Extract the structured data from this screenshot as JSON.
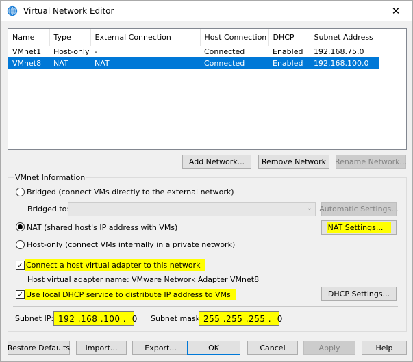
{
  "window": {
    "title": "Virtual Network Editor",
    "close": "✕"
  },
  "list": {
    "columns": [
      "Name",
      "Type",
      "External Connection",
      "Host Connection",
      "DHCP",
      "Subnet Address"
    ],
    "rows": [
      {
        "name": "VMnet1",
        "type": "Host-only",
        "external": "-",
        "host": "Connected",
        "dhcp": "Enabled",
        "subnet": "192.168.75.0"
      },
      {
        "name": "VMnet8",
        "type": "NAT",
        "external": "NAT",
        "host": "Connected",
        "dhcp": "Enabled",
        "subnet": "192.168.100.0"
      }
    ]
  },
  "buttons": {
    "add_network": "Add Network...",
    "remove_network": "Remove Network",
    "rename_network": "Rename Network...",
    "automatic_settings": "Automatic Settings...",
    "nat_settings": "NAT Settings...",
    "dhcp_settings": "DHCP Settings...",
    "restore_defaults": "Restore Defaults",
    "import": "Import...",
    "export": "Export...",
    "ok": "OK",
    "cancel": "Cancel",
    "apply": "Apply",
    "help": "Help"
  },
  "vmnet_info": {
    "group_label": "VMnet Information",
    "bridged_label": "Bridged (connect VMs directly to the external network)",
    "bridged_to_label": "Bridged to:",
    "bridged_to_value": "",
    "nat_label": "NAT (shared host's IP address with VMs)",
    "hostonly_label": "Host-only (connect VMs internally in a private network)",
    "connect_adapter_label": "Connect a host virtual adapter to this network",
    "adapter_name_text": "Host virtual adapter name: VMware Network Adapter VMnet8",
    "use_dhcp_label": "Use local DHCP service to distribute IP address to VMs",
    "subnet_ip_label": "Subnet IP:",
    "subnet_ip_value": "192 .168 .100 .  0",
    "subnet_mask_label": "Subnet mask:",
    "subnet_mask_value": "255 .255 .255 .  0",
    "selected_mode": "nat"
  },
  "colors": {
    "selection": "#0078d7",
    "highlight": "#ffff00"
  }
}
